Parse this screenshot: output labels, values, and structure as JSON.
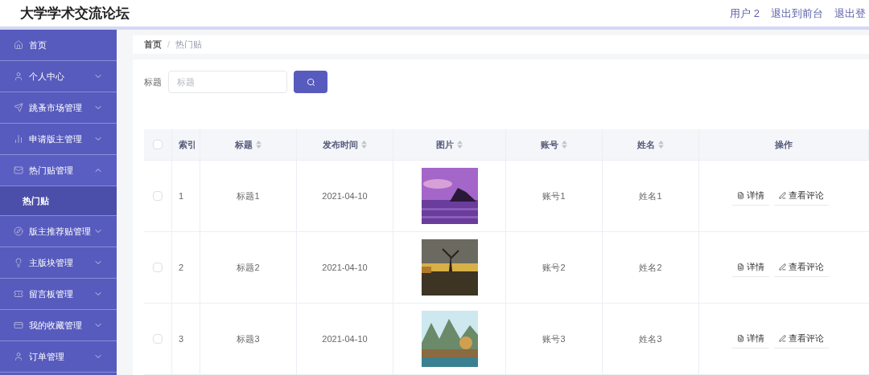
{
  "header": {
    "title": "大学学术交流论坛",
    "links": [
      "用户 2",
      "退出到前台",
      "退出登"
    ]
  },
  "sidebar": {
    "items": [
      {
        "label": "首页",
        "kind": "link"
      },
      {
        "label": "个人中心",
        "kind": "menu",
        "expanded": false
      },
      {
        "label": "跳蚤市场管理",
        "kind": "menu",
        "expanded": false
      },
      {
        "label": "申请版主管理",
        "kind": "menu",
        "expanded": false
      },
      {
        "label": "热门贴管理",
        "kind": "menu",
        "expanded": true,
        "children": [
          {
            "label": "热门贴",
            "selected": true
          }
        ]
      },
      {
        "label": "版主推荐贴管理",
        "kind": "menu",
        "expanded": false
      },
      {
        "label": "主版块管理",
        "kind": "menu",
        "expanded": false
      },
      {
        "label": "留言板管理",
        "kind": "menu",
        "expanded": false
      },
      {
        "label": "我的收藏管理",
        "kind": "menu",
        "expanded": false
      },
      {
        "label": "订单管理",
        "kind": "menu",
        "expanded": false
      }
    ]
  },
  "breadcrumb": {
    "separator": "/",
    "items": [
      "首页",
      "热门贴"
    ]
  },
  "search": {
    "label": "标题",
    "placeholder": "标题"
  },
  "table": {
    "all_checked": false,
    "columns": [
      {
        "label": "索引",
        "sortable": false
      },
      {
        "label": "标题",
        "sortable": true
      },
      {
        "label": "发布时间",
        "sortable": true
      },
      {
        "label": "图片",
        "sortable": true
      },
      {
        "label": "账号",
        "sortable": true
      },
      {
        "label": "姓名",
        "sortable": true
      },
      {
        "label": "操作",
        "sortable": false
      }
    ],
    "rows": [
      {
        "checked": false,
        "index": "1",
        "title": "标题1",
        "time": "2021-04-10",
        "image": {
          "kind": "picture"
        },
        "account": "账号1",
        "name": "姓名1",
        "actions": [
          "详情",
          "查看评论"
        ]
      },
      {
        "checked": false,
        "index": "2",
        "title": "标题2",
        "time": "2021-04-10",
        "image": {
          "kind": "picture"
        },
        "account": "账号2",
        "name": "姓名2",
        "actions": [
          "详情",
          "查看评论"
        ]
      },
      {
        "checked": false,
        "index": "3",
        "title": "标题3",
        "time": "2021-04-10",
        "image": {
          "kind": "picture"
        },
        "account": "账号3",
        "name": "姓名3",
        "actions": [
          "详情",
          "查看评论"
        ]
      }
    ]
  }
}
